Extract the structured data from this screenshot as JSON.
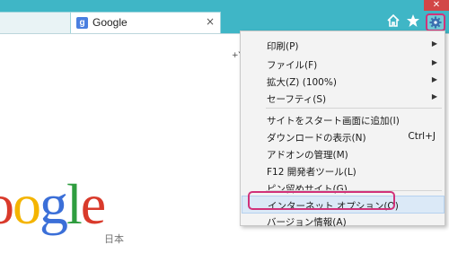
{
  "window": {
    "close_glyph": "✕"
  },
  "tab": {
    "favicon_letter": "g",
    "title": "Google",
    "close_glyph": "×"
  },
  "nav": {
    "home_icon": "home-icon",
    "favorites_icon": "star-icon",
    "tools_icon": "gear-icon"
  },
  "page": {
    "snippet": "+Y",
    "logo_letters": [
      {
        "ch": "o",
        "color": "#d93a2b"
      },
      {
        "ch": "o",
        "color": "#f4b400"
      },
      {
        "ch": "g",
        "color": "#3b6fd8"
      },
      {
        "ch": "l",
        "color": "#2f9d3f"
      },
      {
        "ch": "e",
        "color": "#d93a2b"
      }
    ],
    "logo_sub": "日本"
  },
  "menu": {
    "items": [
      {
        "label": "印刷(P)",
        "submenu": true
      },
      {
        "label": "ファイル(F)",
        "submenu": true
      },
      {
        "label": "拡大(Z) (100%)",
        "submenu": true
      },
      {
        "label": "セーフティ(S)",
        "submenu": true
      },
      {
        "label": "サイトをスタート画面に追加(I)"
      },
      {
        "label": "ダウンロードの表示(N)",
        "shortcut": "Ctrl+J"
      },
      {
        "label": "アドオンの管理(M)"
      },
      {
        "label": "F12 開発者ツール(L)"
      },
      {
        "label": "ピン留めサイト(G)"
      },
      {
        "label": "インターネット オプション(O)",
        "highlight": true
      },
      {
        "label": "バージョン情報(A)"
      }
    ],
    "arrow_glyph": "▶"
  }
}
